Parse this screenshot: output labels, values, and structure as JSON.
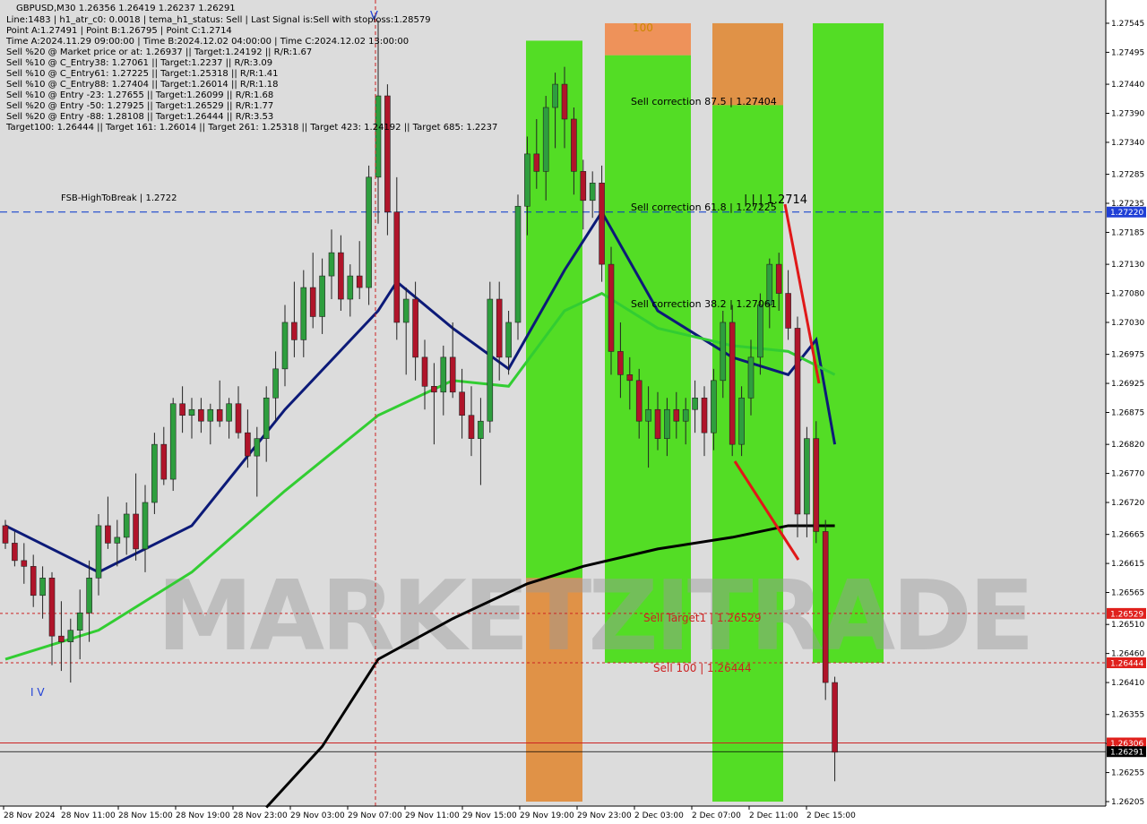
{
  "header": {
    "symbol_line": "GBPUSD,M30  1.26356 1.26419 1.26237 1.26291",
    "lines": [
      "Line:1483  |  h1_atr_c0: 0.0018  |  tema_h1_status: Sell  |  Last Signal is:Sell with stoploss:1.28579",
      "Point A:1.27491  |  Point B:1.26795  |  Point C:1.2714",
      "Time A:2024.11.29 09:00:00  |  Time B:2024.12.02 04:00:00  |  Time C:2024.12.02 13:00:00",
      "Sell %20 @ Market price or at: 1.26937  ||  Target:1.24192  ||  R/R:1.67",
      "Sell %10 @ C_Entry38: 1.27061  ||  Target:1.2237  ||  R/R:3.09",
      "Sell %10 @ C_Entry61: 1.27225  ||  Target:1.25318  ||  R/R:1.41",
      "Sell %10 @ C_Entry88: 1.27404  ||  Target:1.26014  ||  R/R:1.18",
      "Sell %10 @ Entry -23: 1.27655  ||  Target:1.26099  ||  R/R:1.68",
      "Sell %20 @ Entry -50: 1.27925  ||  Target:1.26529  ||  R/R:1.77",
      "Sell %20 @ Entry -88: 1.28108  ||  Target:1.26444  ||  R/R:3.53",
      "Target100: 1.26444  ||  Target 161: 1.26014  ||  Target 261: 1.25318  ||  Target 423: 1.24192  ||  Target 685: 1.2237"
    ]
  },
  "watermark": "MARKETZITRADE",
  "labels": {
    "fsb": "FSB-HighToBreak  |  1.2722",
    "sell_correction_875": "Sell correction 87.5 | 1.27404",
    "sell_correction_618": "Sell correction 61.8 | 1.27225",
    "sell_correction_382": "Sell correction 38.2 | 1.27061",
    "sell_target1": "Sell Target1  |  1.26529",
    "sell_100": "Sell 100  |  1.26444",
    "level_100": "100",
    "point_c_label": "| | | 1.2714",
    "wave_label": "I V"
  },
  "colors": {
    "bull_candle": "#2e9e3e",
    "bear_candle": "#b0142a",
    "ema_navy": "#0c1a78",
    "ema_green": "#32cd32",
    "ema_black": "#000000",
    "zone_green": "#44dd11",
    "zone_orange": "#f08a4b",
    "hline_blue": "#0033cc",
    "hline_red": "#cc2222",
    "price_box_red": "#e0201c",
    "price_box_blue": "#1f3fd6"
  },
  "chart_data": {
    "type": "candlestick",
    "symbol": "GBPUSD",
    "timeframe": "M30",
    "ohlc_last": {
      "open": 1.26356,
      "high": 1.26419,
      "low": 1.26237,
      "close": 1.26291
    },
    "ylim": [
      1.26205,
      1.27565
    ],
    "y_ticks": [
      "1.27545",
      "1.27495",
      "1.27440",
      "1.27390",
      "1.27340",
      "1.27285",
      "1.27235",
      "1.27185",
      "1.27130",
      "1.27080",
      "1.27030",
      "1.26975",
      "1.26925",
      "1.26875",
      "1.26820",
      "1.26770",
      "1.26720",
      "1.26665",
      "1.26615",
      "1.26565",
      "1.26510",
      "1.26460",
      "1.26410",
      "1.26355",
      "1.26305",
      "1.26255",
      "1.26205"
    ],
    "x_ticks": [
      "28 Nov 2024",
      "28 Nov 11:00",
      "28 Nov 15:00",
      "28 Nov 19:00",
      "28 Nov 23:00",
      "29 Nov 03:00",
      "29 Nov 07:00",
      "29 Nov 11:00",
      "29 Nov 15:00",
      "29 Nov 19:00",
      "29 Nov 23:00",
      "2 Dec 03:00",
      "2 Dec 07:00",
      "2 Dec 11:00",
      "2 Dec 15:00"
    ],
    "price_levels": [
      {
        "name": "FSB-HighToBreak",
        "price": 1.2722,
        "label": "1.27220",
        "color": "#0033cc"
      },
      {
        "name": "Sell Target1",
        "price": 1.26529,
        "label": "1.26529",
        "color": "#cc2222"
      },
      {
        "name": "Sell 100",
        "price": 1.26444,
        "label": "1.26444",
        "color": "#cc2222"
      },
      {
        "name": "Stop",
        "price": 1.26306,
        "label": "1.26306",
        "color": "#cc2222"
      },
      {
        "name": "Current",
        "price": 1.26291,
        "label": "1.26291",
        "color": "#000000"
      }
    ],
    "zones": [
      {
        "x": [
          587,
          650
        ],
        "y": [
          1.26205,
          1.27515
        ],
        "type": "green"
      },
      {
        "x": [
          587,
          650
        ],
        "y": [
          1.26205,
          1.2659
        ],
        "type": "orange"
      },
      {
        "x": [
          675,
          771
        ],
        "y": [
          1.26444,
          1.2749
        ],
        "type": "green"
      },
      {
        "x": [
          675,
          771
        ],
        "y": [
          1.2749,
          1.27545
        ],
        "type": "orange"
      },
      {
        "x": [
          795,
          874
        ],
        "y": [
          1.26205,
          1.27545
        ],
        "type": "green"
      },
      {
        "x": [
          795,
          874
        ],
        "y": [
          1.27404,
          1.27545
        ],
        "type": "orange"
      },
      {
        "x": [
          907,
          986
        ],
        "y": [
          1.26444,
          1.27545
        ],
        "type": "green"
      }
    ],
    "candles": [
      [
        1.2668,
        1.2669,
        1.2664,
        1.2665
      ],
      [
        1.2665,
        1.2667,
        1.2661,
        1.2662
      ],
      [
        1.2662,
        1.2665,
        1.2658,
        1.2661
      ],
      [
        1.2661,
        1.2663,
        1.2654,
        1.2656
      ],
      [
        1.2656,
        1.2661,
        1.2652,
        1.2659
      ],
      [
        1.2659,
        1.266,
        1.2644,
        1.2649
      ],
      [
        1.2649,
        1.2655,
        1.2643,
        1.2648
      ],
      [
        1.2648,
        1.2652,
        1.2641,
        1.265
      ],
      [
        1.265,
        1.2657,
        1.2645,
        1.2653
      ],
      [
        1.2653,
        1.2662,
        1.2648,
        1.2659
      ],
      [
        1.2659,
        1.267,
        1.2656,
        1.2668
      ],
      [
        1.2668,
        1.2673,
        1.2664,
        1.2665
      ],
      [
        1.2665,
        1.2669,
        1.2661,
        1.2666
      ],
      [
        1.2666,
        1.2672,
        1.2663,
        1.267
      ],
      [
        1.267,
        1.2677,
        1.2662,
        1.2664
      ],
      [
        1.2664,
        1.2675,
        1.266,
        1.2672
      ],
      [
        1.2672,
        1.2684,
        1.267,
        1.2682
      ],
      [
        1.2682,
        1.2685,
        1.2675,
        1.2676
      ],
      [
        1.2676,
        1.269,
        1.2674,
        1.2689
      ],
      [
        1.2689,
        1.2692,
        1.2684,
        1.2687
      ],
      [
        1.2687,
        1.269,
        1.2683,
        1.2688
      ],
      [
        1.2688,
        1.269,
        1.2684,
        1.2686
      ],
      [
        1.2686,
        1.2689,
        1.2682,
        1.2688
      ],
      [
        1.2688,
        1.2693,
        1.2685,
        1.2686
      ],
      [
        1.2686,
        1.269,
        1.2683,
        1.2689
      ],
      [
        1.2689,
        1.2692,
        1.2683,
        1.2684
      ],
      [
        1.2684,
        1.2688,
        1.2678,
        1.268
      ],
      [
        1.268,
        1.2685,
        1.2673,
        1.2683
      ],
      [
        1.2683,
        1.2692,
        1.2679,
        1.269
      ],
      [
        1.269,
        1.2698,
        1.2686,
        1.2695
      ],
      [
        1.2695,
        1.2706,
        1.2692,
        1.2703
      ],
      [
        1.2703,
        1.271,
        1.2697,
        1.27
      ],
      [
        1.27,
        1.2712,
        1.2697,
        1.2709
      ],
      [
        1.2709,
        1.2715,
        1.2702,
        1.2704
      ],
      [
        1.2704,
        1.2714,
        1.2701,
        1.2711
      ],
      [
        1.2711,
        1.2719,
        1.2707,
        1.2715
      ],
      [
        1.2715,
        1.2718,
        1.2705,
        1.2707
      ],
      [
        1.2707,
        1.2713,
        1.2704,
        1.2711
      ],
      [
        1.2711,
        1.2717,
        1.2707,
        1.2709
      ],
      [
        1.2709,
        1.273,
        1.2706,
        1.2728
      ],
      [
        1.2728,
        1.2755,
        1.272,
        1.2742
      ],
      [
        1.2742,
        1.2744,
        1.2718,
        1.2722
      ],
      [
        1.2722,
        1.2728,
        1.27,
        1.2703
      ],
      [
        1.2703,
        1.2709,
        1.2694,
        1.2707
      ],
      [
        1.2707,
        1.271,
        1.2693,
        1.2697
      ],
      [
        1.2697,
        1.27,
        1.2688,
        1.2692
      ],
      [
        1.2692,
        1.2696,
        1.2682,
        1.2691
      ],
      [
        1.2691,
        1.2699,
        1.2687,
        1.2697
      ],
      [
        1.2697,
        1.2703,
        1.269,
        1.2691
      ],
      [
        1.2691,
        1.2695,
        1.2683,
        1.2687
      ],
      [
        1.2687,
        1.2692,
        1.268,
        1.2683
      ],
      [
        1.2683,
        1.269,
        1.2675,
        1.2686
      ],
      [
        1.2686,
        1.271,
        1.2684,
        1.2707
      ],
      [
        1.2707,
        1.271,
        1.2693,
        1.2697
      ],
      [
        1.2697,
        1.2705,
        1.2694,
        1.2703
      ],
      [
        1.2703,
        1.2725,
        1.27,
        1.2723
      ],
      [
        1.2723,
        1.2735,
        1.2718,
        1.2732
      ],
      [
        1.2732,
        1.2738,
        1.2726,
        1.2729
      ],
      [
        1.2729,
        1.2742,
        1.2724,
        1.274
      ],
      [
        1.274,
        1.2746,
        1.2733,
        1.2744
      ],
      [
        1.2744,
        1.2747,
        1.2733,
        1.2738
      ],
      [
        1.2738,
        1.274,
        1.2725,
        1.2729
      ],
      [
        1.2729,
        1.2731,
        1.2719,
        1.2724
      ],
      [
        1.2724,
        1.2729,
        1.2721,
        1.2727
      ],
      [
        1.2727,
        1.273,
        1.271,
        1.2713
      ],
      [
        1.2713,
        1.2716,
        1.2694,
        1.2698
      ],
      [
        1.2698,
        1.2703,
        1.269,
        1.2694
      ],
      [
        1.2694,
        1.2697,
        1.2688,
        1.2693
      ],
      [
        1.2693,
        1.2695,
        1.2683,
        1.2686
      ],
      [
        1.2686,
        1.2692,
        1.2678,
        1.2688
      ],
      [
        1.2688,
        1.2691,
        1.2681,
        1.2683
      ],
      [
        1.2683,
        1.269,
        1.268,
        1.2688
      ],
      [
        1.2688,
        1.2691,
        1.2683,
        1.2686
      ],
      [
        1.2686,
        1.269,
        1.2682,
        1.2688
      ],
      [
        1.2688,
        1.2693,
        1.2684,
        1.269
      ],
      [
        1.269,
        1.2692,
        1.268,
        1.2684
      ],
      [
        1.2684,
        1.2695,
        1.2681,
        1.2693
      ],
      [
        1.2693,
        1.2705,
        1.269,
        1.2703
      ],
      [
        1.2703,
        1.2706,
        1.268,
        1.2682
      ],
      [
        1.2682,
        1.2692,
        1.268,
        1.269
      ],
      [
        1.269,
        1.27,
        1.2687,
        1.2697
      ],
      [
        1.2697,
        1.2708,
        1.2694,
        1.2706
      ],
      [
        1.2706,
        1.2714,
        1.2702,
        1.2713
      ],
      [
        1.2713,
        1.2715,
        1.2705,
        1.2708
      ],
      [
        1.2708,
        1.2712,
        1.27,
        1.2702
      ],
      [
        1.2702,
        1.2704,
        1.2666,
        1.267
      ],
      [
        1.267,
        1.2685,
        1.2666,
        1.2683
      ],
      [
        1.2683,
        1.2686,
        1.2665,
        1.2667
      ],
      [
        1.2667,
        1.2669,
        1.2638,
        1.2641
      ],
      [
        1.2641,
        1.2642,
        1.2624,
        1.2629
      ]
    ],
    "moving_averages": [
      {
        "color": "#0c1a78",
        "points": [
          [
            1.2668,
            0
          ],
          [
            1.266,
            10
          ],
          [
            1.2668,
            20
          ],
          [
            1.2688,
            30
          ],
          [
            1.2705,
            40
          ],
          [
            1.271,
            42
          ],
          [
            1.2702,
            48
          ],
          [
            1.2695,
            54
          ],
          [
            1.2712,
            60
          ],
          [
            1.2722,
            64
          ],
          [
            1.2705,
            70
          ],
          [
            1.2697,
            78
          ],
          [
            1.2694,
            84
          ],
          [
            1.27,
            87
          ],
          [
            1.2682,
            89
          ]
        ]
      },
      {
        "color": "#32cd32",
        "points": [
          [
            1.2645,
            0
          ],
          [
            1.265,
            10
          ],
          [
            1.266,
            20
          ],
          [
            1.2674,
            30
          ],
          [
            1.2687,
            40
          ],
          [
            1.2693,
            48
          ],
          [
            1.2692,
            54
          ],
          [
            1.2705,
            60
          ],
          [
            1.2708,
            64
          ],
          [
            1.2702,
            70
          ],
          [
            1.2699,
            78
          ],
          [
            1.2698,
            84
          ],
          [
            1.2694,
            89
          ]
        ]
      },
      {
        "color": "#000000",
        "points": [
          [
            1.26195,
            28
          ],
          [
            1.263,
            34
          ],
          [
            1.2645,
            40
          ],
          [
            1.2652,
            48
          ],
          [
            1.2658,
            56
          ],
          [
            1.2661,
            62
          ],
          [
            1.2664,
            70
          ],
          [
            1.2666,
            78
          ],
          [
            1.2668,
            84
          ],
          [
            1.2668,
            89
          ]
        ]
      }
    ]
  }
}
